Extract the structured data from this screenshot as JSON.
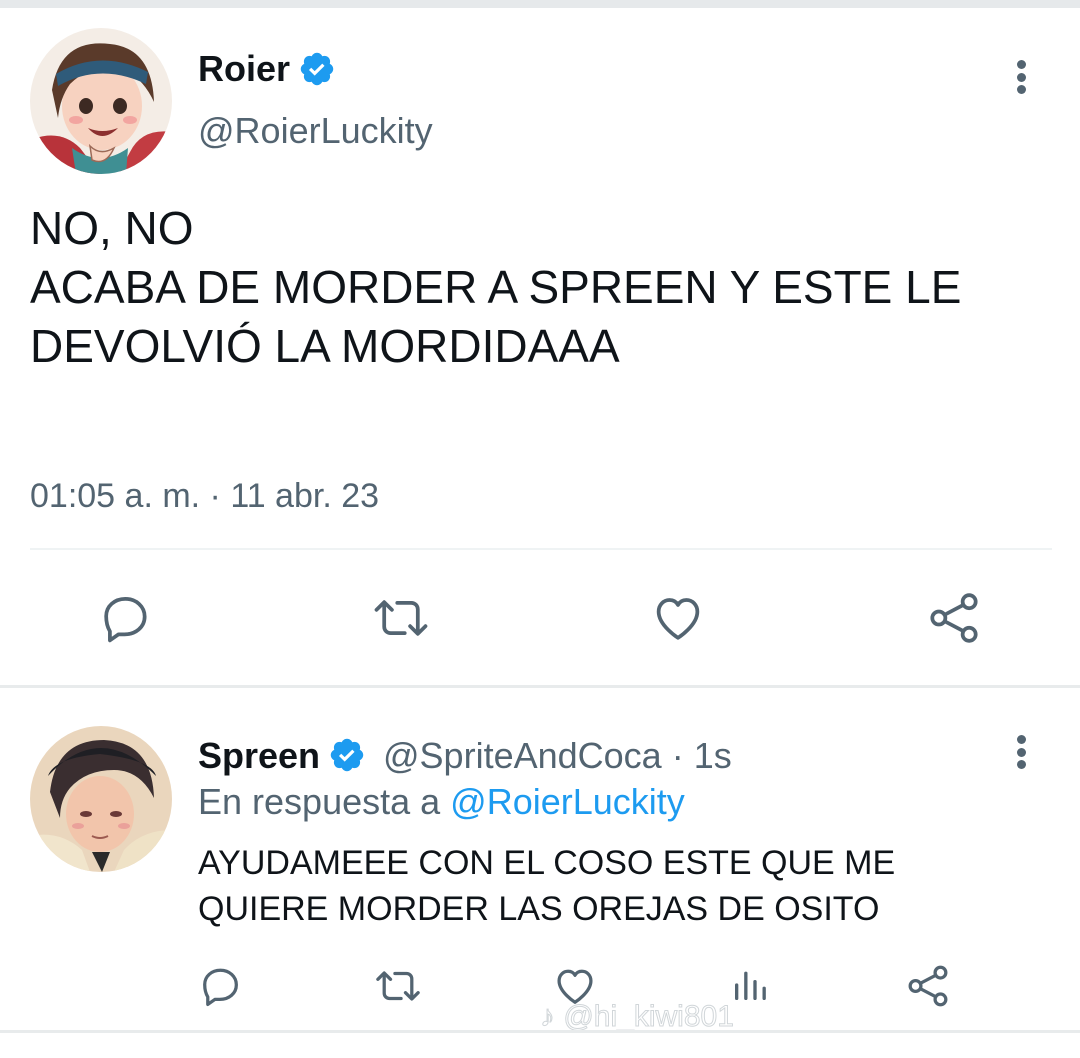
{
  "tweet": {
    "author_name": "Roier",
    "author_handle": "@RoierLuckity",
    "text_line1": "NO, NO",
    "text_line2": "ACABA DE MORDER A SPREEN Y ESTE LE",
    "text_line3": "DEVOLVIÓ LA MORDIDAAA",
    "timestamp": "01:05 a. m. · 11 abr. 23",
    "actions": [
      "reply-icon",
      "retweet-icon",
      "like-icon",
      "share-icon"
    ]
  },
  "reply": {
    "author_name": "Spreen",
    "author_handle": "@SpriteAndCoca",
    "time": "· 1s",
    "reply_prefix": "En respuesta a",
    "reply_to": "@RoierLuckity",
    "text_line1": "AYUDAMEEE CON EL COSO ESTE QUE ME",
    "text_line2": "QUIERE MORDER LAS OREJAS DE OSITO",
    "actions": [
      "reply-icon",
      "retweet-icon",
      "like-icon",
      "analytics-icon",
      "share-icon"
    ]
  },
  "watermark": "@hi_kiwi801",
  "colors": {
    "accent": "#1d9bf0",
    "muted": "#536471",
    "text": "#0f1419"
  }
}
